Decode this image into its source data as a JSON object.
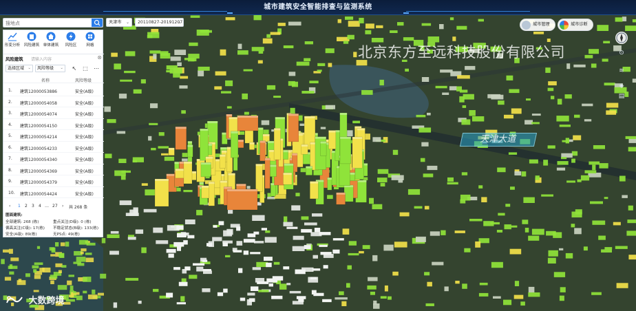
{
  "app": {
    "title": "城市建筑安全智能排查与监测系统"
  },
  "search": {
    "placeholder": "搜地点"
  },
  "toolbar": {
    "city": "天津市",
    "date_range": "20110827-20191207"
  },
  "tools": [
    {
      "label": "形变分析",
      "icon": "line-chart-icon"
    },
    {
      "label": "风险建筑",
      "icon": "building-warning-icon"
    },
    {
      "label": "单体建筑",
      "icon": "house-icon"
    },
    {
      "label": "风险区",
      "icon": "bolt-icon"
    },
    {
      "label": "网格",
      "icon": "grid-icon"
    }
  ],
  "risk_panel": {
    "title": "风险建筑",
    "search_placeholder": "请输入内容",
    "region_select": "选择区域",
    "level_select": "风险等级",
    "col_name": "名称",
    "col_level": "风险等级"
  },
  "buildings": [
    {
      "n": "1.",
      "name": "建筑12000053886",
      "level": "安全(A级)"
    },
    {
      "n": "2.",
      "name": "建筑12000054058",
      "level": "安全(A级)"
    },
    {
      "n": "3.",
      "name": "建筑12000054074",
      "level": "安全(A级)"
    },
    {
      "n": "4.",
      "name": "建筑12000054150",
      "level": "安全(A级)"
    },
    {
      "n": "5.",
      "name": "建筑12000054214",
      "level": "安全(A级)"
    },
    {
      "n": "6.",
      "name": "建筑12000054233",
      "level": "安全(A级)"
    },
    {
      "n": "7.",
      "name": "建筑12000054340",
      "level": "安全(A级)"
    },
    {
      "n": "8.",
      "name": "建筑12000054369",
      "level": "安全(A级)"
    },
    {
      "n": "9.",
      "name": "建筑12000054379",
      "level": "安全(A级)"
    },
    {
      "n": "10.",
      "name": "建筑12000054424",
      "level": "安全(A级)"
    }
  ],
  "pager": {
    "prev": "‹",
    "p1": "1",
    "p2": "2",
    "p3": "3",
    "p4": "4",
    "ellipsis": "…",
    "plast": "27",
    "next": "›",
    "total": "共 268 条"
  },
  "stats": {
    "header": "图面建筑:",
    "total": "全部建筑: 268 (栋)",
    "heavy": "重点关注(D级): 0 (栋)",
    "moderate": "偏高关注(C级): 17(栋)",
    "unstable": "不稳定状态(B级): 133(栋)",
    "safe": "安全(A级): 89(栋)",
    "no_ps": "无PS点: 49(栋)"
  },
  "right_widgets": {
    "city_mgmt": "城市管理",
    "city_diag": "城市诊断"
  },
  "watermark": "北京东方至远科技股份有限公司",
  "road_label": "天津大道",
  "logo": "大数跨境",
  "colors": {
    "accent": "#2b7de9",
    "title_bar": "#0b1d3a",
    "bldg_green": "#8fe33a",
    "bldg_yellow": "#f2e14a",
    "bldg_orange": "#e8853a"
  }
}
